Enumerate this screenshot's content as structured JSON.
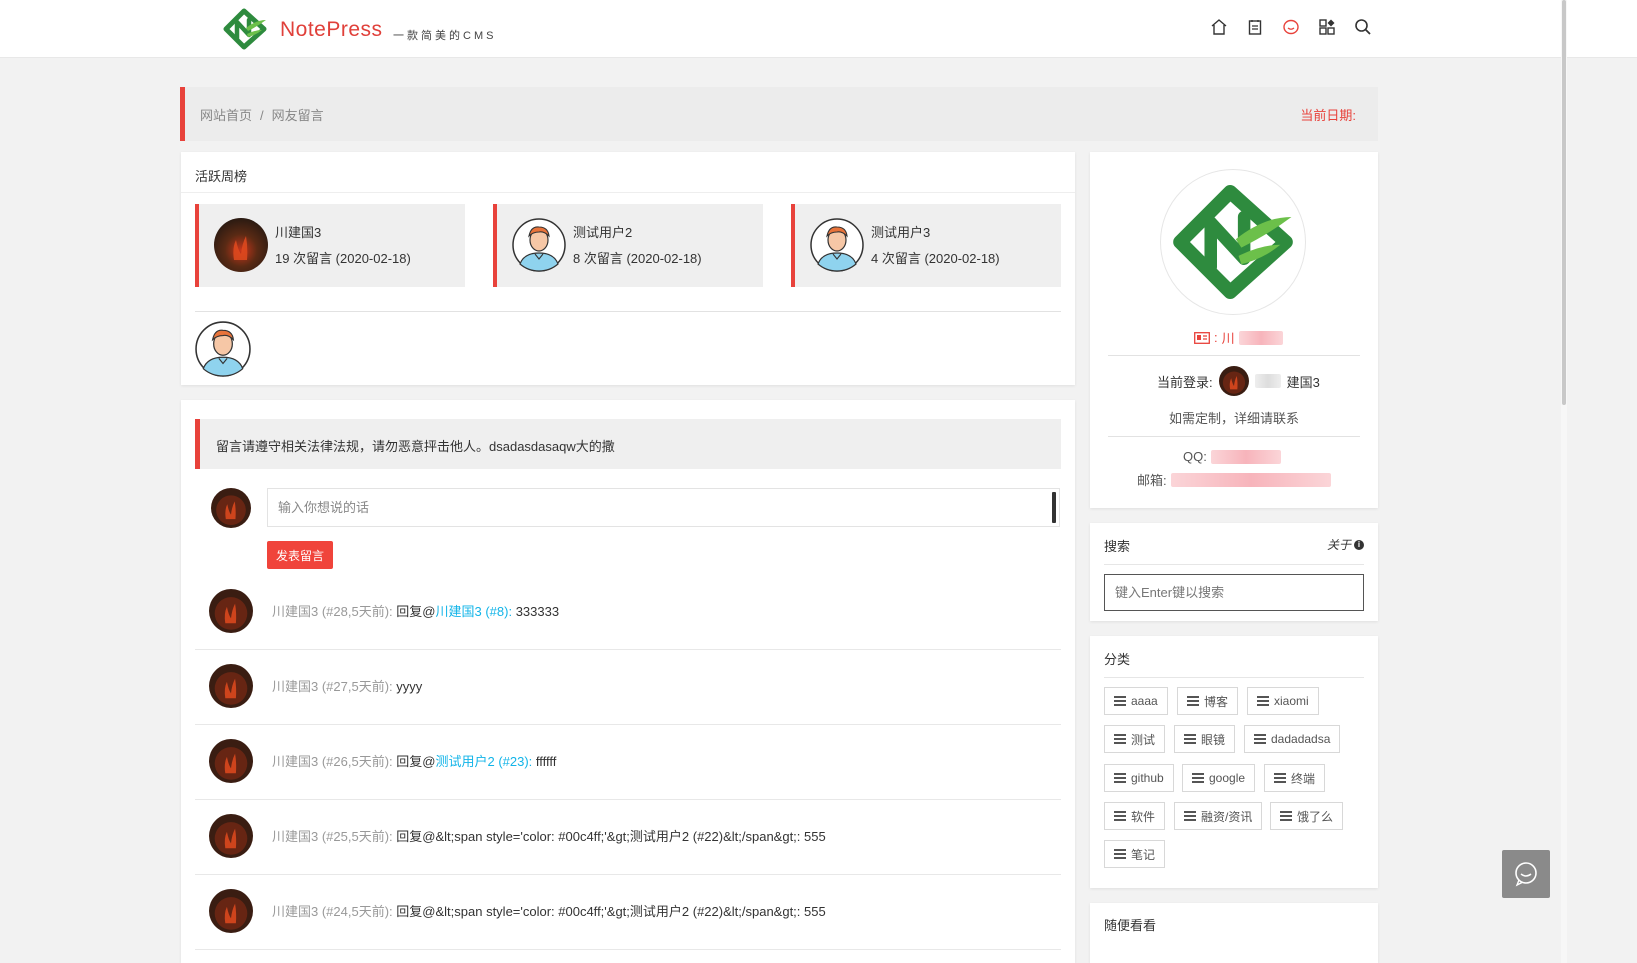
{
  "header": {
    "brand": "NotePress",
    "tagline": "一款简美的CMS",
    "nav_icons": [
      "home-icon",
      "notebook-icon",
      "message-icon",
      "apps-icon",
      "search-icon"
    ]
  },
  "breadcrumb": {
    "home": "网站首页",
    "separator": "/",
    "current": "网友留言",
    "date_label": "当前日期:"
  },
  "weekly": {
    "title": "活跃周榜",
    "top_users": [
      {
        "name": "川建国3",
        "count": "19 次留言 (2020-02-18)"
      },
      {
        "name": "测试用户2",
        "count": "8 次留言 (2020-02-18)"
      },
      {
        "name": "测试用户3",
        "count": "4 次留言 (2020-02-18)"
      }
    ]
  },
  "guestbook": {
    "notice": "留言请遵守相关法律法规，请勿恶意抨击他人。dsadasdasaqw大的撒",
    "input_placeholder": "输入你想说的话",
    "post_button": "发表留言",
    "comments": [
      {
        "author": "川建国3 (#28,5天前):",
        "prefix": "回复@",
        "mention": "川建国3 (#8):",
        "text": "333333"
      },
      {
        "author": "川建国3 (#27,5天前):",
        "prefix": "",
        "mention": "",
        "text": "yyyy"
      },
      {
        "author": "川建国3 (#26,5天前):",
        "prefix": "回复@",
        "mention": "测试用户2 (#23):",
        "text": "ffffff"
      },
      {
        "author": "川建国3 (#25,5天前):",
        "prefix": "",
        "mention": "",
        "text": "回复@&lt;span style='color: #00c4ff;'&gt;测试用户2 (#22)&lt;/span&gt;: 555"
      },
      {
        "author": "川建国3 (#24,5天前):",
        "prefix": "",
        "mention": "",
        "text": "回复@&lt;span style='color: #00c4ff;'&gt;测试用户2 (#22)&lt;/span&gt;: 555"
      }
    ]
  },
  "profile": {
    "id_label": ":",
    "id_value_visible": "川",
    "login_label": "当前登录:",
    "login_name_visible": "建国3",
    "custom_text": "如需定制，详细请联系",
    "qq_label": "QQ:",
    "mail_label": "邮箱:"
  },
  "search": {
    "title": "搜索",
    "about": "关于",
    "placeholder": "键入Enter键以搜索"
  },
  "categories": {
    "title": "分类",
    "tags": [
      "aaaa",
      "博客",
      "xiaomi",
      "测试",
      "眼镜",
      "dadadadsa",
      "github",
      "google",
      "终端",
      "软件",
      "融资/资讯",
      "饿了么",
      "笔记"
    ]
  },
  "next_widget": {
    "title": "随便看看"
  },
  "colors": {
    "accent": "#e8423b",
    "mention": "#12b4e8",
    "logo_green": "#2e8b3e",
    "logo_light": "#6cc04a"
  }
}
